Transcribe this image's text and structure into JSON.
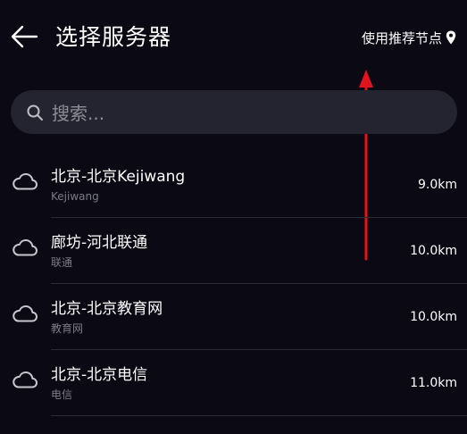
{
  "header": {
    "title": "选择服务器",
    "recommend_label": "使用推荐节点",
    "back_icon": "arrow-left-icon",
    "recommend_icon": "location-pin-icon"
  },
  "search": {
    "placeholder": "搜索...",
    "icon": "search-icon"
  },
  "servers": [
    {
      "name": "北京-北京Kejiwang",
      "sub": "Kejiwang",
      "distance": "9.0km",
      "icon": "cloud-icon"
    },
    {
      "name": "廊坊-河北联通",
      "sub": "联通",
      "distance": "10.0km",
      "icon": "cloud-icon"
    },
    {
      "name": "北京-北京教育网",
      "sub": "教育网",
      "distance": "10.0km",
      "icon": "cloud-icon"
    },
    {
      "name": "北京-北京电信",
      "sub": "电信",
      "distance": "11.0km",
      "icon": "cloud-icon"
    }
  ],
  "annotation": {
    "color": "#e0141e",
    "type": "arrow-up"
  },
  "colors": {
    "background": "#0a0914",
    "search_background": "#232430",
    "primary_text": "#ffffff",
    "secondary_text": "#7c7c86"
  }
}
